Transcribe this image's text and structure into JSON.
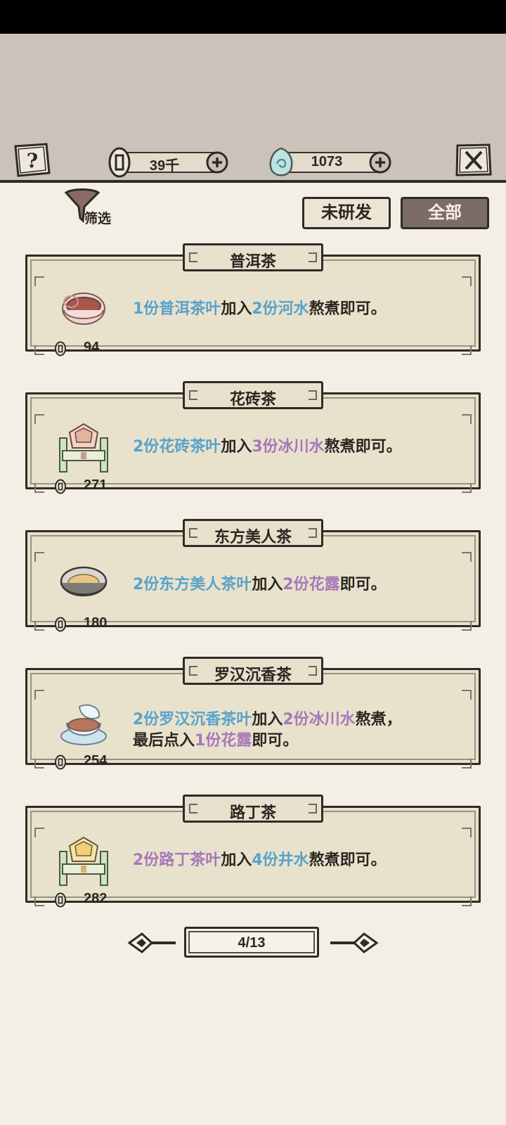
{
  "header": {
    "currencies": [
      {
        "name": "coin",
        "value": "39千"
      },
      {
        "name": "jade",
        "value": "1073"
      }
    ]
  },
  "filter": {
    "label": "筛选"
  },
  "tabs": [
    {
      "label": "未研发",
      "active": false
    },
    {
      "label": "全部",
      "active": true
    }
  ],
  "colors": {
    "ingredient_blue": "#5aa2c8",
    "ingredient_purple": "#a877b8",
    "active_tab": "#7b6d66"
  },
  "teas": [
    {
      "name": "普洱茶",
      "price": "94",
      "image": "red-tea-cup",
      "recipe": [
        [
          {
            "t": "1份普洱茶叶",
            "c": "blue"
          },
          {
            "t": "加入",
            "c": ""
          },
          {
            "t": "2份河水",
            "c": "blue"
          },
          {
            "t": "熬煮即可。",
            "c": ""
          }
        ]
      ]
    },
    {
      "name": "花砖茶",
      "price": "271",
      "image": "tea-brick-stand",
      "recipe": [
        [
          {
            "t": "2份花砖茶叶",
            "c": "blue"
          },
          {
            "t": "加入",
            "c": ""
          },
          {
            "t": "3份冰川水",
            "c": "purple"
          },
          {
            "t": "熬煮即可。",
            "c": ""
          }
        ]
      ]
    },
    {
      "name": "东方美人茶",
      "price": "180",
      "image": "tea-bowl",
      "recipe": [
        [
          {
            "t": "2份东方美人茶叶",
            "c": "blue"
          },
          {
            "t": "加入",
            "c": ""
          },
          {
            "t": "2份花露",
            "c": "purple"
          },
          {
            "t": "即可。",
            "c": ""
          }
        ]
      ]
    },
    {
      "name": "罗汉沉香茶",
      "price": "254",
      "image": "lidded-tea-cup",
      "recipe": [
        [
          {
            "t": "2份罗汉沉香茶叶",
            "c": "blue"
          },
          {
            "t": "加入",
            "c": ""
          },
          {
            "t": "2份冰川水",
            "c": "purple"
          },
          {
            "t": "熬煮，",
            "c": ""
          }
        ],
        [
          {
            "t": "最后点入",
            "c": ""
          },
          {
            "t": "1份花露",
            "c": "purple"
          },
          {
            "t": "即可。",
            "c": ""
          }
        ]
      ]
    },
    {
      "name": "路丁茶",
      "price": "282",
      "image": "tea-brick-stand-yellow",
      "recipe": [
        [
          {
            "t": "2份路丁茶叶",
            "c": "purple"
          },
          {
            "t": "加入",
            "c": ""
          },
          {
            "t": "4份井水",
            "c": "blue"
          },
          {
            "t": "熬煮即可。",
            "c": ""
          }
        ]
      ]
    }
  ],
  "pager": {
    "text": "4/13"
  }
}
